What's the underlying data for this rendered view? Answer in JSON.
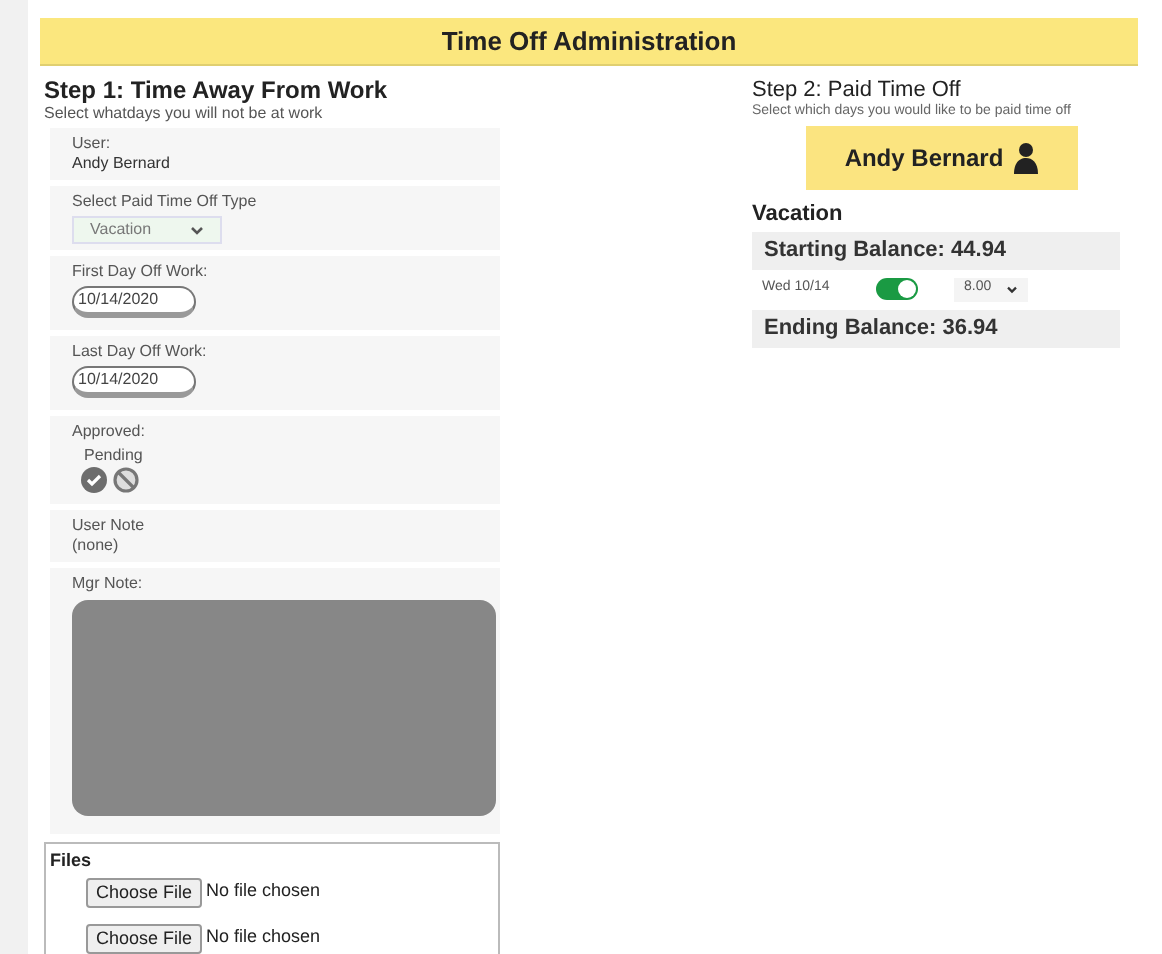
{
  "header": {
    "title": "Time Off Administration"
  },
  "step1": {
    "title": "Step 1: Time Away From Work",
    "subtitle": "Select whatdays you will not be at work",
    "user": {
      "label": "User:",
      "value": "Andy Bernard"
    },
    "type": {
      "label": "Select Paid Time Off Type",
      "value": "Vacation"
    },
    "first_day": {
      "label": "First Day Off Work:",
      "value": "10/14/2020"
    },
    "last_day": {
      "label": "Last Day Off Work:",
      "value": "10/14/2020"
    },
    "approved": {
      "label": "Approved:",
      "status": "Pending"
    },
    "user_note": {
      "label": "User Note",
      "value": "(none)"
    },
    "mgr_note": {
      "label": "Mgr Note:"
    }
  },
  "files": {
    "title": "Files",
    "inputs": [
      {
        "button": "Choose File",
        "status": "No file chosen"
      },
      {
        "button": "Choose File",
        "status": "No file chosen"
      }
    ]
  },
  "step2": {
    "title": "Step 2: Paid Time Off",
    "subtitle": "Select which days you would like to be paid time off",
    "employee": "Andy Bernard",
    "category": "Vacation",
    "starting": "Starting Balance: 44.94",
    "days": [
      {
        "day": "Wed 10/14",
        "on": true,
        "hours": "8.00"
      }
    ],
    "ending": "Ending Balance: 36.94"
  }
}
